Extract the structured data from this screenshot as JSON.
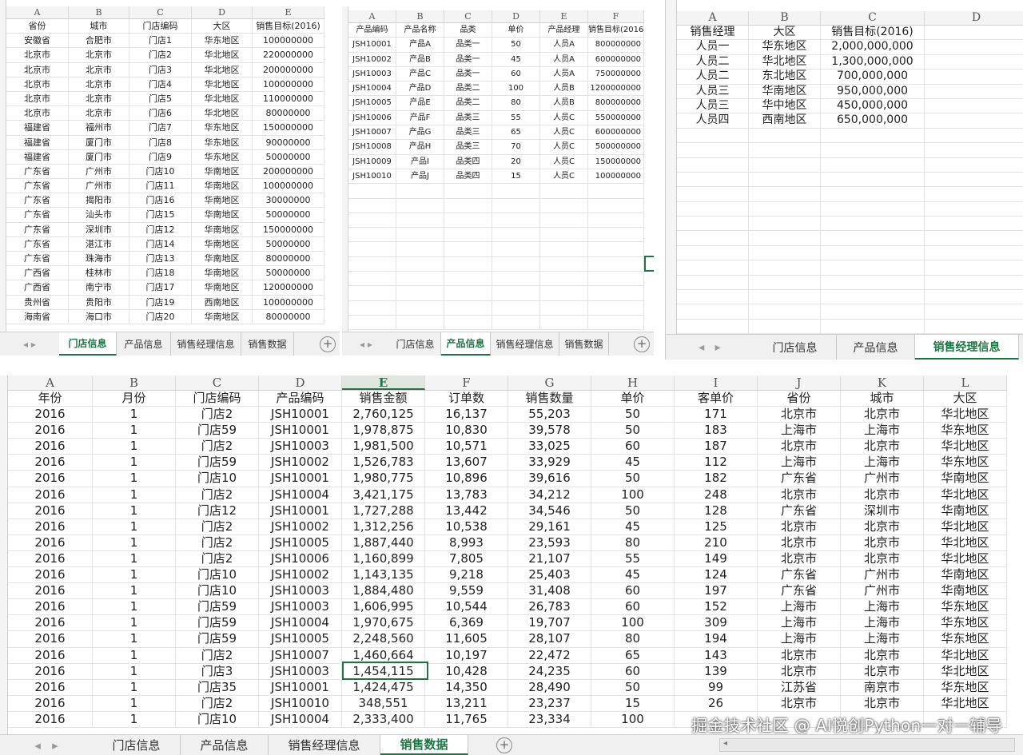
{
  "sheet_tabs": [
    "门店信息",
    "产品信息",
    "销售经理信息",
    "销售数据"
  ],
  "store_sheet": {
    "columns": [
      "A",
      "B",
      "C",
      "D",
      "E"
    ],
    "headers": [
      "省份",
      "城市",
      "门店编码",
      "大区",
      "销售目标(2016)"
    ],
    "rows": [
      [
        "安徽省",
        "合肥市",
        "门店1",
        "华东地区",
        "100000000"
      ],
      [
        "北京市",
        "北京市",
        "门店2",
        "华北地区",
        "220000000"
      ],
      [
        "北京市",
        "北京市",
        "门店3",
        "华北地区",
        "200000000"
      ],
      [
        "北京市",
        "北京市",
        "门店4",
        "华北地区",
        "100000000"
      ],
      [
        "北京市",
        "北京市",
        "门店5",
        "华北地区",
        "110000000"
      ],
      [
        "北京市",
        "北京市",
        "门店6",
        "华北地区",
        "80000000"
      ],
      [
        "福建省",
        "福州市",
        "门店7",
        "华东地区",
        "150000000"
      ],
      [
        "福建省",
        "厦门市",
        "门店8",
        "华东地区",
        "90000000"
      ],
      [
        "福建省",
        "厦门市",
        "门店9",
        "华东地区",
        "50000000"
      ],
      [
        "广东省",
        "广州市",
        "门店10",
        "华南地区",
        "200000000"
      ],
      [
        "广东省",
        "广州市",
        "门店11",
        "华南地区",
        "100000000"
      ],
      [
        "广东省",
        "揭阳市",
        "门店16",
        "华南地区",
        "30000000"
      ],
      [
        "广东省",
        "汕头市",
        "门店15",
        "华南地区",
        "50000000"
      ],
      [
        "广东省",
        "深圳市",
        "门店12",
        "华南地区",
        "150000000"
      ],
      [
        "广东省",
        "湛江市",
        "门店14",
        "华南地区",
        "50000000"
      ],
      [
        "广东省",
        "珠海市",
        "门店13",
        "华南地区",
        "80000000"
      ],
      [
        "广西省",
        "桂林市",
        "门店18",
        "华南地区",
        "50000000"
      ],
      [
        "广西省",
        "南宁市",
        "门店17",
        "华南地区",
        "120000000"
      ],
      [
        "贵州省",
        "贵阳市",
        "门店19",
        "西南地区",
        "100000000"
      ],
      [
        "海南省",
        "海口市",
        "门店20",
        "华南地区",
        "80000000"
      ]
    ]
  },
  "product_sheet": {
    "columns": [
      "A",
      "B",
      "C",
      "D",
      "E",
      "F"
    ],
    "headers": [
      "产品编码",
      "产品名称",
      "品类",
      "单价",
      "产品经理",
      "销售目标(2016)"
    ],
    "rows": [
      [
        "JSH10001",
        "产品A",
        "品类一",
        "50",
        "人员A",
        "800000000"
      ],
      [
        "JSH10002",
        "产品B",
        "品类一",
        "45",
        "人员A",
        "600000000"
      ],
      [
        "JSH10003",
        "产品C",
        "品类一",
        "60",
        "人员A",
        "750000000"
      ],
      [
        "JSH10004",
        "产品D",
        "品类二",
        "100",
        "人员B",
        "1200000000"
      ],
      [
        "JSH10005",
        "产品E",
        "品类二",
        "80",
        "人员B",
        "800000000"
      ],
      [
        "JSH10006",
        "产品F",
        "品类三",
        "55",
        "人员C",
        "550000000"
      ],
      [
        "JSH10007",
        "产品G",
        "品类三",
        "65",
        "人员C",
        "600000000"
      ],
      [
        "JSH10008",
        "产品H",
        "品类三",
        "70",
        "人员C",
        "500000000"
      ],
      [
        "JSH10009",
        "产品I",
        "品类四",
        "20",
        "人员C",
        "150000000"
      ],
      [
        "JSH10010",
        "产品J",
        "品类四",
        "15",
        "人员C",
        "100000000"
      ]
    ]
  },
  "manager_sheet": {
    "columns": [
      "A",
      "B",
      "C",
      "D"
    ],
    "headers": [
      "销售经理",
      "大区",
      "销售目标(2016)",
      ""
    ],
    "rows": [
      [
        "人员一",
        "华东地区",
        "2,000,000,000",
        ""
      ],
      [
        "人员二",
        "华北地区",
        "1,300,000,000",
        ""
      ],
      [
        "人员二",
        "东北地区",
        "700,000,000",
        ""
      ],
      [
        "人员三",
        "华南地区",
        "950,000,000",
        ""
      ],
      [
        "人员三",
        "华中地区",
        "450,000,000",
        ""
      ],
      [
        "人员四",
        "西南地区",
        "650,000,000",
        ""
      ]
    ]
  },
  "sales_sheet": {
    "columns": [
      "A",
      "B",
      "C",
      "D",
      "E",
      "F",
      "G",
      "H",
      "I",
      "J",
      "K",
      "L"
    ],
    "headers": [
      "年份",
      "月份",
      "门店编码",
      "产品编码",
      "销售金额",
      "订单数",
      "销售数量",
      "单价",
      "客单价",
      "省份",
      "城市",
      "大区"
    ],
    "rows": [
      [
        "2016",
        "1",
        "门店2",
        "JSH10001",
        "2,760,125",
        "16,137",
        "55,203",
        "50",
        "171",
        "北京市",
        "北京市",
        "华北地区"
      ],
      [
        "2016",
        "1",
        "门店59",
        "JSH10001",
        "1,978,875",
        "10,830",
        "39,578",
        "50",
        "183",
        "上海市",
        "上海市",
        "华东地区"
      ],
      [
        "2016",
        "1",
        "门店2",
        "JSH10003",
        "1,981,500",
        "10,571",
        "33,025",
        "60",
        "187",
        "北京市",
        "北京市",
        "华北地区"
      ],
      [
        "2016",
        "1",
        "门店59",
        "JSH10002",
        "1,526,783",
        "13,607",
        "33,929",
        "45",
        "112",
        "上海市",
        "上海市",
        "华东地区"
      ],
      [
        "2016",
        "1",
        "门店10",
        "JSH10001",
        "1,980,775",
        "10,896",
        "39,616",
        "50",
        "182",
        "广东省",
        "广州市",
        "华南地区"
      ],
      [
        "2016",
        "1",
        "门店2",
        "JSH10004",
        "3,421,175",
        "13,783",
        "34,212",
        "100",
        "248",
        "北京市",
        "北京市",
        "华北地区"
      ],
      [
        "2016",
        "1",
        "门店12",
        "JSH10001",
        "1,727,288",
        "13,442",
        "34,546",
        "50",
        "128",
        "广东省",
        "深圳市",
        "华南地区"
      ],
      [
        "2016",
        "1",
        "门店2",
        "JSH10002",
        "1,312,256",
        "10,538",
        "29,161",
        "45",
        "125",
        "北京市",
        "北京市",
        "华北地区"
      ],
      [
        "2016",
        "1",
        "门店2",
        "JSH10005",
        "1,887,440",
        "8,993",
        "23,593",
        "80",
        "210",
        "北京市",
        "北京市",
        "华北地区"
      ],
      [
        "2016",
        "1",
        "门店2",
        "JSH10006",
        "1,160,899",
        "7,805",
        "21,107",
        "55",
        "149",
        "北京市",
        "北京市",
        "华北地区"
      ],
      [
        "2016",
        "1",
        "门店10",
        "JSH10002",
        "1,143,135",
        "9,218",
        "25,403",
        "45",
        "124",
        "广东省",
        "广州市",
        "华南地区"
      ],
      [
        "2016",
        "1",
        "门店10",
        "JSH10003",
        "1,884,480",
        "9,559",
        "31,408",
        "60",
        "197",
        "广东省",
        "广州市",
        "华南地区"
      ],
      [
        "2016",
        "1",
        "门店59",
        "JSH10003",
        "1,606,995",
        "10,544",
        "26,783",
        "60",
        "152",
        "上海市",
        "上海市",
        "华东地区"
      ],
      [
        "2016",
        "1",
        "门店59",
        "JSH10004",
        "1,970,675",
        "6,369",
        "19,707",
        "100",
        "309",
        "上海市",
        "上海市",
        "华东地区"
      ],
      [
        "2016",
        "1",
        "门店59",
        "JSH10005",
        "2,248,560",
        "11,605",
        "28,107",
        "80",
        "194",
        "上海市",
        "上海市",
        "华东地区"
      ],
      [
        "2016",
        "1",
        "门店2",
        "JSH10007",
        "1,460,664",
        "10,197",
        "22,472",
        "65",
        "143",
        "北京市",
        "北京市",
        "华北地区"
      ],
      [
        "2016",
        "1",
        "门店3",
        "JSH10003",
        "1,454,115",
        "10,428",
        "24,235",
        "60",
        "139",
        "北京市",
        "北京市",
        "华北地区"
      ],
      [
        "2016",
        "1",
        "门店35",
        "JSH10001",
        "1,424,475",
        "14,350",
        "28,490",
        "50",
        "99",
        "江苏省",
        "南京市",
        "华东地区"
      ],
      [
        "2016",
        "1",
        "门店2",
        "JSH10010",
        "348,551",
        "13,211",
        "23,237",
        "15",
        "26",
        "北京市",
        "北京市",
        "华北地区"
      ],
      [
        "2016",
        "1",
        "门店10",
        "JSH10004",
        "2,333,400",
        "11,765",
        "23,334",
        "100",
        "",
        "",
        "",
        ""
      ]
    ]
  },
  "watermark": "掘金技术社区 @ AI悦创Python一对一辅导",
  "icons": {
    "add_sheet": "plus-circle-icon",
    "prev": "triangle-left-icon",
    "next": "triangle-right-icon"
  }
}
